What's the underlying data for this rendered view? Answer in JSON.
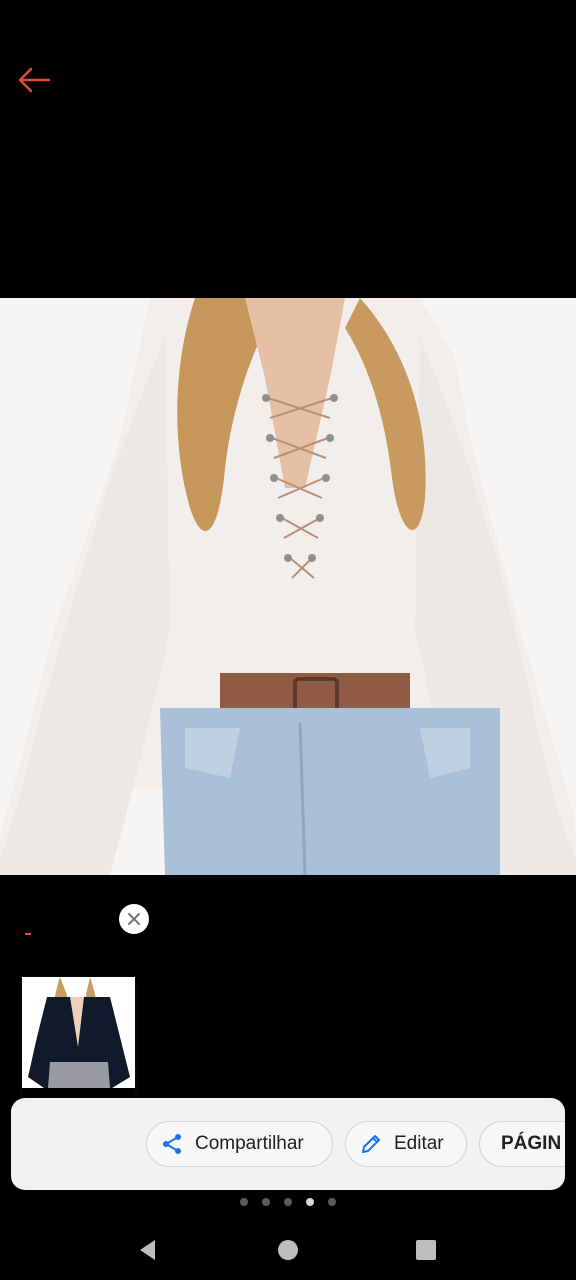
{
  "viewer": {
    "back_icon": "arrow-left-icon",
    "accent_color": "#e34a3b"
  },
  "main_image": {
    "subject": "white lace-up long-sleeve blouse with denim shorts"
  },
  "thumbnail": {
    "subject": "black lace-up long-sleeve blouse",
    "close_icon": "close-icon"
  },
  "actions": {
    "share": {
      "label": "Compartilhar",
      "icon": "share-icon"
    },
    "edit": {
      "label": "Editar",
      "icon": "pencil-icon"
    },
    "page": {
      "label": "PÁGIN"
    }
  },
  "pager": {
    "count": 5,
    "active": 4
  },
  "nav": {
    "back": "triangle-back-icon",
    "home": "circle-home-icon",
    "recents": "square-recents-icon"
  }
}
